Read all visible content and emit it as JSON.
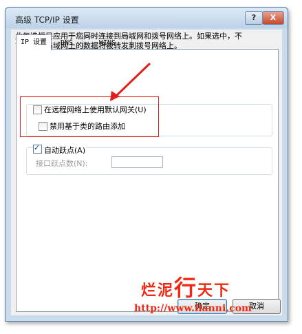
{
  "window": {
    "title": "高级 TCP/IP 设置",
    "help_label": "?",
    "close_label": "X"
  },
  "tabs": [
    {
      "label": "IP 设置",
      "active": true
    },
    {
      "label": "DNS",
      "active": false
    },
    {
      "label": "WINS",
      "active": false
    }
  ],
  "description": "此复选框只应用于您同时连接到局域网和拨号网络上。如果选中，不能发送到局域网上的数据将被转发到拨号网络上。",
  "options": {
    "use_default_gateway": {
      "label": "在远程网络上使用默认网关(U)",
      "checked": false
    },
    "disable_class_route": {
      "label": "禁用基于类的路由添加",
      "checked": false
    },
    "auto_metric": {
      "label": "自动跃点(A)",
      "checked": true
    },
    "interface_metric": {
      "label": "接口跃点数(N):",
      "value": "",
      "enabled": false
    }
  },
  "buttons": {
    "ok": "确定",
    "cancel": "取消"
  },
  "watermark": {
    "line1_a": "烂泥",
    "line1_b": "行",
    "line1_c": "天下",
    "line2": "http://www.ilanni.com"
  },
  "colors": {
    "accent_red": "#e0201a",
    "watermark_red": "#ee2a14"
  }
}
